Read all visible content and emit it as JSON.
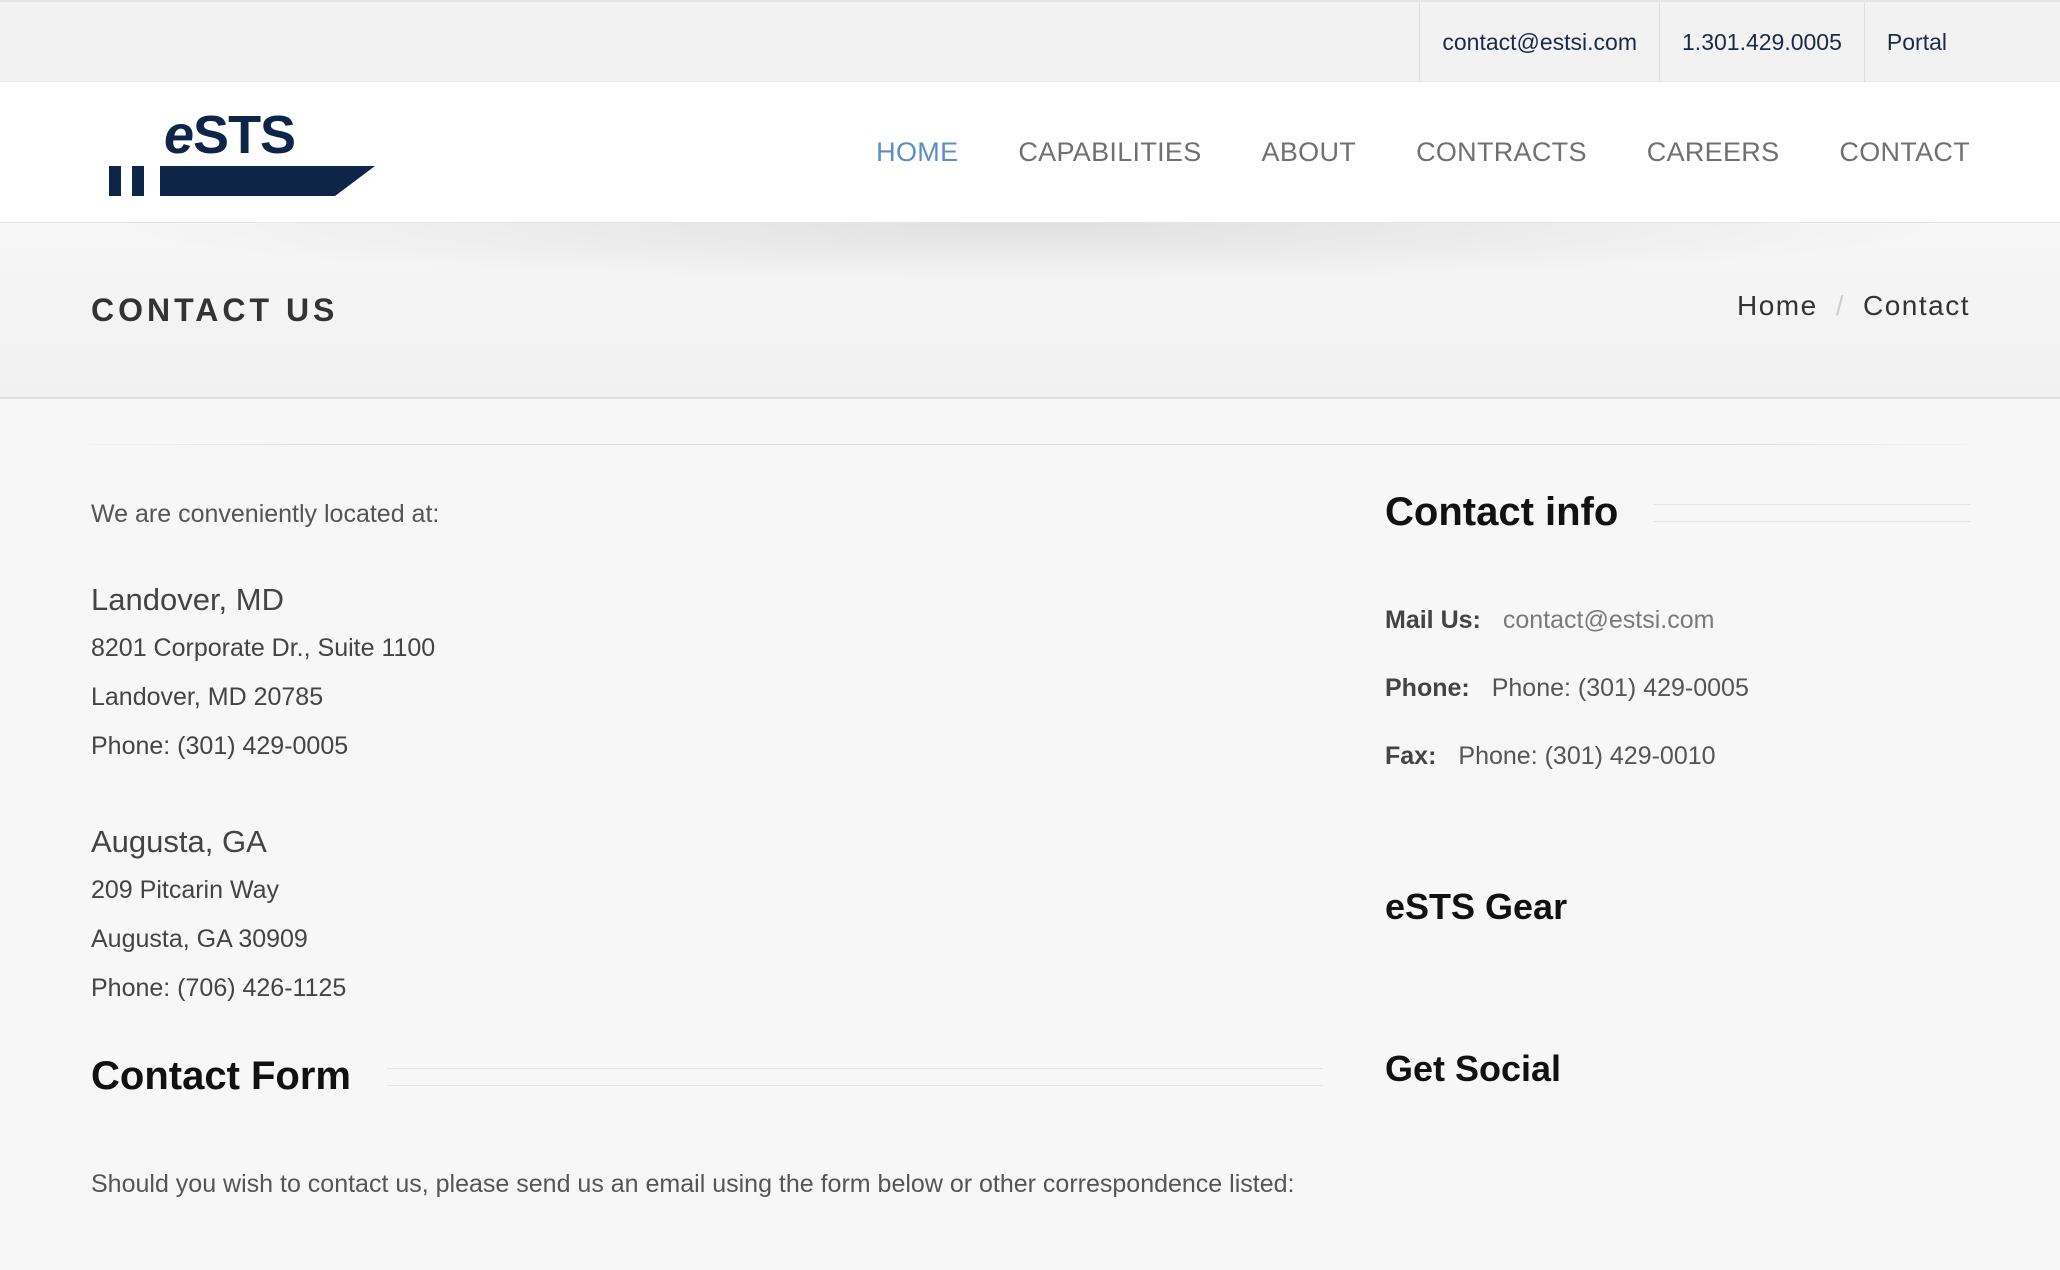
{
  "topbar": {
    "email": "contact@estsi.com",
    "phone": "1.301.429.0005",
    "portal": "Portal"
  },
  "logo": {
    "text_e": "e",
    "text_rest": "STS",
    "colors": {
      "brand": "#0e2547"
    }
  },
  "nav": {
    "items": [
      {
        "label": "HOME",
        "active": true
      },
      {
        "label": "CAPABILITIES"
      },
      {
        "label": "ABOUT"
      },
      {
        "label": "CONTRACTS"
      },
      {
        "label": "CAREERS"
      },
      {
        "label": "CONTACT"
      }
    ],
    "active_color": "#5b8ec9"
  },
  "page": {
    "title": "CONTACT US",
    "breadcrumb": {
      "home": "Home",
      "separator": "/",
      "current": "Contact"
    }
  },
  "locations": {
    "intro": "We are conveniently located at:",
    "list": [
      {
        "name": "Landover, MD",
        "street": "8201 Corporate Dr., Suite 1100",
        "city": "Landover, MD 20785",
        "phone": "Phone: (301) 429-0005"
      },
      {
        "name": "Augusta, GA",
        "street": "209 Pitcarin Way",
        "city": "Augusta, GA 30909",
        "phone": "Phone: (706) 426-1125"
      }
    ]
  },
  "contact_form": {
    "heading": "Contact Form",
    "text": "Should you wish to contact us, please send us an email using the form below or other correspondence listed:"
  },
  "contact_info": {
    "heading": "Contact info",
    "mail_label": "Mail Us:",
    "mail_value": "contact@estsi.com",
    "phone_label": "Phone:",
    "phone_value": "Phone: (301) 429-0005",
    "fax_label": "Fax:",
    "fax_value": "Phone: (301) 429-0010"
  },
  "gear": {
    "heading": "eSTS Gear"
  },
  "social": {
    "heading": "Get Social"
  }
}
